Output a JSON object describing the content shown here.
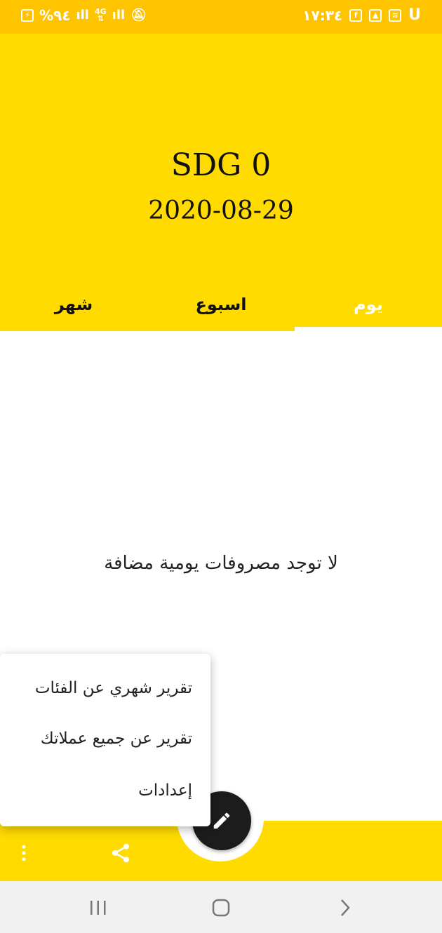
{
  "status_bar": {
    "time": "١٧:٣٤",
    "battery": "%٩٤",
    "network": "4G",
    "notification_icons": [
      "charging-icon",
      "signal-icon",
      "4g-signal-icon",
      "signal-icon",
      "mute-icon",
      "u-icon",
      "wifi-icon",
      "image-icon",
      "facebook-icon"
    ]
  },
  "header": {
    "balance": "SDG 0",
    "date": "2020-08-29",
    "background": "#FFDB00"
  },
  "tabs": [
    {
      "label": "شهر",
      "selected": false
    },
    {
      "label": "اسبوع",
      "selected": false
    },
    {
      "label": "يوم",
      "selected": true
    }
  ],
  "empty_message": "لا توجد مصروفات يومية مضافة",
  "menu": {
    "items": [
      {
        "label": "تقرير شهري عن الفئات"
      },
      {
        "label": "تقرير عن جميع عملاتك"
      },
      {
        "label": "إعدادات"
      }
    ]
  },
  "bottom_bar": {
    "icons": [
      "more-vert-icon",
      "moon-icon",
      "share-icon"
    ],
    "fab_icon": "pencil-icon"
  },
  "nav_bar": {
    "icons": [
      "recent-apps-icon",
      "home-icon",
      "back-icon"
    ]
  },
  "colors": {
    "accent": "#FFDB00",
    "status_bar": "#FFC400",
    "fab": "#1c1c1c"
  }
}
